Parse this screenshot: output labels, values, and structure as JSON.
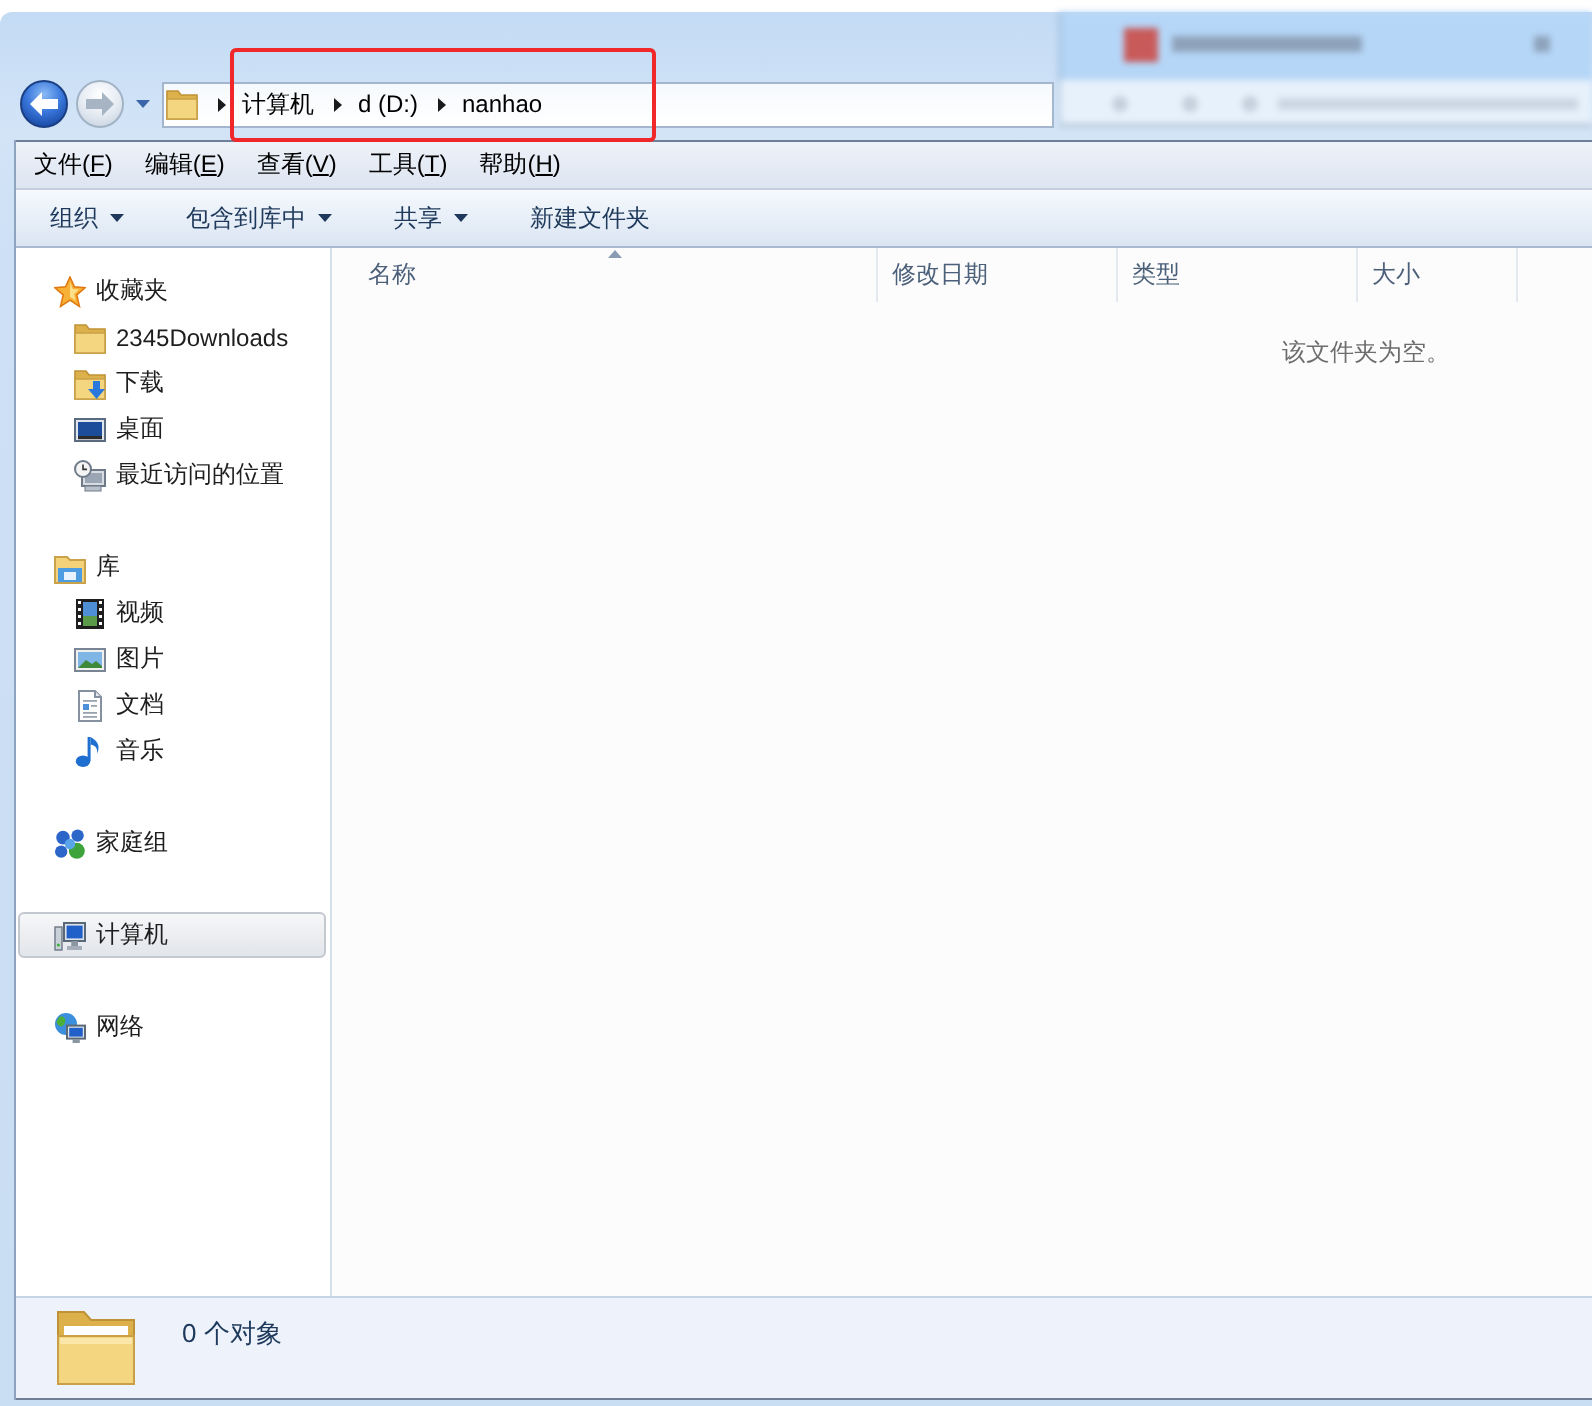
{
  "window": {
    "nav_buttons": [
      {
        "kind": "back",
        "disabled": false
      },
      {
        "kind": "forward",
        "disabled": true
      }
    ],
    "address_bar": {
      "segments": [
        "计算机",
        "d (D:)",
        "nanhao"
      ]
    }
  },
  "menu_bar": [
    {
      "label": "文件",
      "access_key": "(F)"
    },
    {
      "label": "编辑",
      "access_key": "(E)"
    },
    {
      "label": "查看",
      "access_key": "(V)"
    },
    {
      "label": "工具",
      "access_key": "(T)"
    },
    {
      "label": "帮助",
      "access_key": "(H)"
    }
  ],
  "command_bar": [
    {
      "label": "组织",
      "dropdown": true
    },
    {
      "label": "包含到库中",
      "dropdown": true
    },
    {
      "label": "共享",
      "dropdown": true
    },
    {
      "label": "新建文件夹",
      "dropdown": false
    }
  ],
  "navigation_pane": [
    {
      "label": "收藏夹",
      "kind": "favorites",
      "selected": false,
      "children": [
        {
          "label": "2345Downloads",
          "kind": "folder",
          "selected": false
        },
        {
          "label": "下载",
          "kind": "downloads",
          "selected": false
        },
        {
          "label": "桌面",
          "kind": "desktop",
          "selected": false
        },
        {
          "label": "最近访问的位置",
          "kind": "recent",
          "selected": false
        }
      ]
    },
    {
      "label": "库",
      "kind": "libraries",
      "selected": false,
      "children": [
        {
          "label": "视频",
          "kind": "videos",
          "selected": false
        },
        {
          "label": "图片",
          "kind": "pictures",
          "selected": false
        },
        {
          "label": "文档",
          "kind": "documents",
          "selected": false
        },
        {
          "label": "音乐",
          "kind": "music",
          "selected": false
        }
      ]
    },
    {
      "label": "家庭组",
      "kind": "homegroup",
      "selected": false
    },
    {
      "label": "计算机",
      "kind": "computer",
      "selected": true
    },
    {
      "label": "网络",
      "kind": "network",
      "selected": false
    }
  ],
  "file_list": {
    "columns": [
      {
        "label": "名称",
        "sorted": true
      },
      {
        "label": "修改日期",
        "sorted": false
      },
      {
        "label": "类型",
        "sorted": false
      },
      {
        "label": "大小",
        "sorted": false
      }
    ],
    "empty_message": "该文件夹为空。"
  },
  "status_bar": {
    "item_count": "0 个对象"
  },
  "annotations": [
    {
      "kind": "rectangle"
    }
  ]
}
